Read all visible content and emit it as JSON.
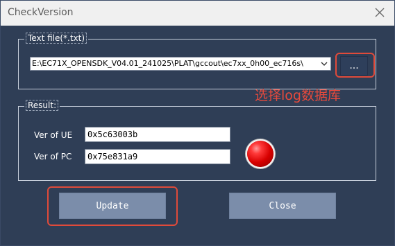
{
  "window": {
    "title": "CheckVersion",
    "close_icon": "close-icon"
  },
  "text_file_group": {
    "label": "Text file(*.txt)",
    "file_path": "E:\\EC71X_OPENSDK_V04.01_241025\\PLAT\\gccout\\ec7xx_0h00_ec716s\\",
    "browse_label": "..."
  },
  "annotation": {
    "hint_text": "选择log数据库",
    "color": "#e84a3c"
  },
  "result_group": {
    "label": "Result:",
    "ue_label": "Ver of UE",
    "ue_value": "0x5c63003b",
    "pc_label": "Ver of PC",
    "pc_value": "0x75e831a9",
    "status_color": "#d80000"
  },
  "buttons": {
    "update_label": "Update",
    "close_label": "Close"
  }
}
